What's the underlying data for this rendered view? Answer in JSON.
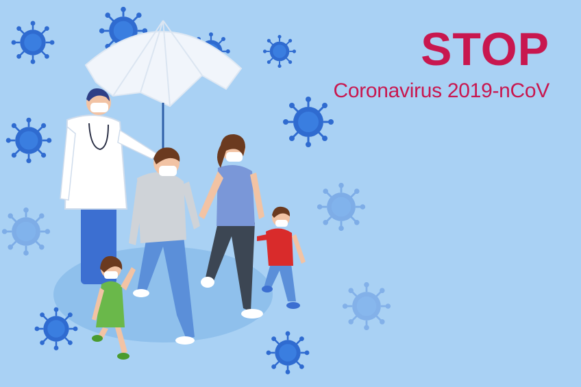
{
  "headline": {
    "title": "STOP",
    "subtitle": "Coronavirus 2019-nCoV"
  },
  "colors": {
    "background": "#a9d1f4",
    "headline": "#c8174f",
    "virus": "#2f6bd0",
    "virus_faded": "#8db8e6",
    "umbrella": "#f1f5fb"
  },
  "icons": [
    "virus-icon",
    "umbrella-icon"
  ]
}
